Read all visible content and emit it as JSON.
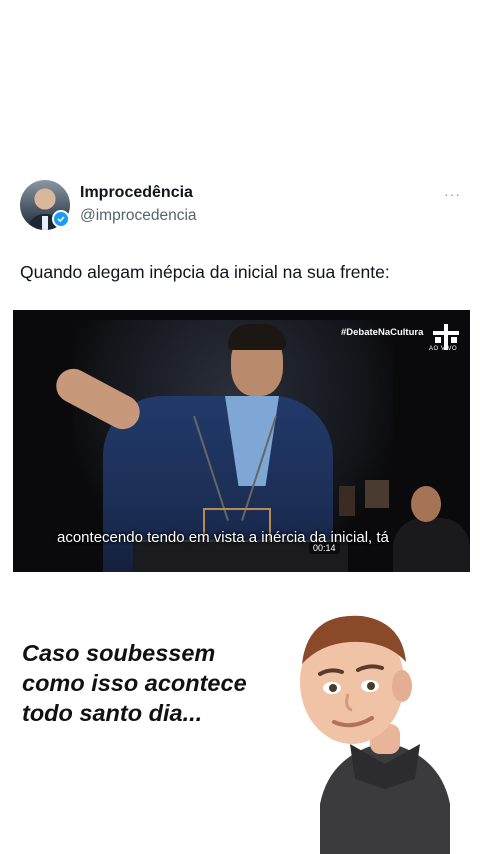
{
  "tweet": {
    "display_name": "Improcedência",
    "handle": "@improcedencia",
    "more_label": "···",
    "text": "Quando alegam inépcia da inicial na sua frente:"
  },
  "video": {
    "hashtag": "#DebateNaCultura",
    "channel_sub": "AO VIVO",
    "caption": "acontecendo tendo em vista a inércia da inicial, tá",
    "timestamp": "00:14"
  },
  "overlay": {
    "line1": "Caso soubessem",
    "line2": "como isso acontece",
    "line3": "todo santo dia..."
  },
  "colors": {
    "verified": "#1d9bf0",
    "handle": "#536471",
    "text": "#0f1419"
  },
  "icons": {
    "verified": "verified-badge-icon",
    "more": "more-options-icon",
    "channel": "tv-cultura-logo"
  }
}
